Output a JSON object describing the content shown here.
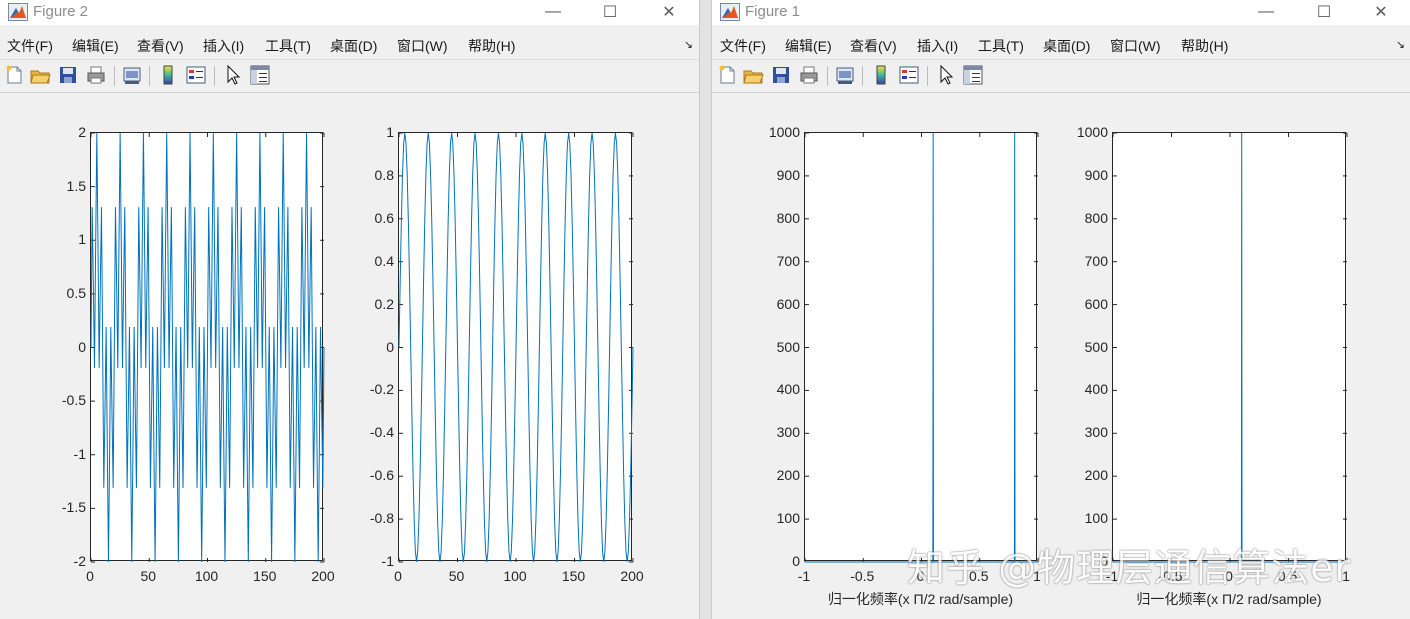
{
  "figure2": {
    "title": "Figure 2",
    "menu": [
      "文件(F)",
      "编辑(E)",
      "查看(V)",
      "插入(I)",
      "工具(T)",
      "桌面(D)",
      "窗口(W)",
      "帮助(H)"
    ],
    "toolbar_icons": [
      "new-figure-icon",
      "open-icon",
      "save-icon",
      "print-icon",
      "link-plot-icon",
      "colorbar-icon",
      "legend-icon",
      "pointer-icon",
      "property-editor-icon"
    ]
  },
  "figure1": {
    "title": "Figure 1",
    "menu": [
      "文件(F)",
      "编辑(E)",
      "查看(V)",
      "插入(I)",
      "工具(T)",
      "桌面(D)",
      "窗口(W)",
      "帮助(H)"
    ],
    "toolbar_icons": [
      "new-figure-icon",
      "open-icon",
      "save-icon",
      "print-icon",
      "link-plot-icon",
      "colorbar-icon",
      "legend-icon",
      "pointer-icon",
      "property-editor-icon"
    ]
  },
  "window_controls": {
    "minimize": "—",
    "maximize": "☐",
    "close": "✕"
  },
  "watermark": "知乎 @物理层通信算法er",
  "chart_data": [
    {
      "id": "fig2-sub1",
      "type": "line",
      "xlim": [
        0,
        200
      ],
      "ylim": [
        -2,
        2
      ],
      "xticks": [
        "0",
        "50",
        "100",
        "150",
        "200"
      ],
      "yticks": [
        "2",
        "1.5",
        "1",
        "0.5",
        "0",
        "-0.5",
        "-1",
        "-1.5",
        "-2"
      ],
      "xlabel": "",
      "ylabel": "",
      "title": "",
      "signal": {
        "components": [
          {
            "amplitude": 1,
            "cycles_per_sample": 0.05
          },
          {
            "amplitude": 1,
            "cycles_per_sample": 0.25
          }
        ],
        "n": [
          0,
          200
        ]
      },
      "color": "#0072bd"
    },
    {
      "id": "fig2-sub2",
      "type": "line",
      "xlim": [
        0,
        200
      ],
      "ylim": [
        -1,
        1
      ],
      "xticks": [
        "0",
        "50",
        "100",
        "150",
        "200"
      ],
      "yticks": [
        "1",
        "0.8",
        "0.6",
        "0.4",
        "0.2",
        "0",
        "-0.2",
        "-0.4",
        "-0.6",
        "-0.8",
        "-1"
      ],
      "xlabel": "",
      "ylabel": "",
      "title": "",
      "signal": {
        "components": [
          {
            "amplitude": 1,
            "cycles_per_sample": 0.05
          }
        ],
        "n": [
          0,
          200
        ]
      },
      "color": "#0072bd"
    },
    {
      "id": "fig1-sub1",
      "type": "line",
      "xlim": [
        -1,
        1
      ],
      "ylim": [
        0,
        1000
      ],
      "xticks": [
        "-1",
        "-0.5",
        "0",
        "0.5",
        "1"
      ],
      "yticks": [
        "1000",
        "900",
        "800",
        "700",
        "600",
        "500",
        "400",
        "300",
        "200",
        "100",
        "0"
      ],
      "xlabel": "归一化频率(x Π/2 rad/sample)",
      "ylabel": "",
      "title": "",
      "spikes": [
        {
          "x": 0.1,
          "y": 1000
        },
        {
          "x": 0.8,
          "y": 1000
        }
      ],
      "baseline": 0,
      "color": "#0072bd"
    },
    {
      "id": "fig1-sub2",
      "type": "line",
      "xlim": [
        -1,
        1
      ],
      "ylim": [
        0,
        1000
      ],
      "xticks": [
        "-1",
        "-0.5",
        "0",
        "0.5",
        "1"
      ],
      "yticks": [
        "1000",
        "900",
        "800",
        "700",
        "600",
        "500",
        "400",
        "300",
        "200",
        "100",
        "0"
      ],
      "xlabel": "归一化频率(x Π/2 rad/sample)",
      "ylabel": "",
      "title": "",
      "spikes": [
        {
          "x": 0.1,
          "y": 1000
        }
      ],
      "baseline": 0,
      "color": "#0072bd"
    }
  ]
}
